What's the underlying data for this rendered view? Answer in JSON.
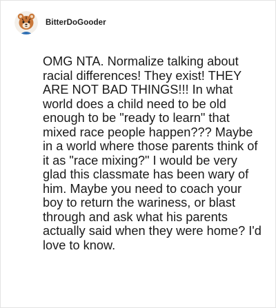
{
  "post": {
    "username": "BitterDoGooder",
    "avatar_icon": "bear-avatar-icon",
    "comment_text": "OMG NTA. Normalize talking about racial differences! They exist! THEY ARE NOT BAD THINGS!!! In what world does a child need to be old enough to be \"ready to learn\" that mixed race people happen??? Maybe in a world where those parents think of it as \"race mixing?\" I would be very glad this classmate has been wary of him. Maybe you need to coach your boy to return the wariness, or blast through and ask what his parents actually said when they were home? I'd love to know."
  },
  "colors": {
    "background": "#ffffff",
    "text": "#1a1a1a",
    "border": "#e3e3e3",
    "avatar_fur": "#c9783a"
  }
}
